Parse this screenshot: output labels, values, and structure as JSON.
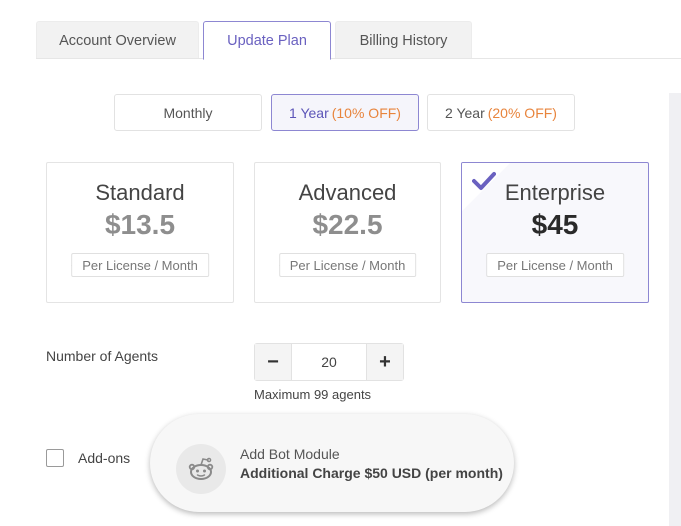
{
  "tabs": [
    {
      "label": "Account Overview",
      "active": false
    },
    {
      "label": "Update Plan",
      "active": true
    },
    {
      "label": "Billing History",
      "active": false
    }
  ],
  "durations": [
    {
      "label": "Monthly",
      "discount": ""
    },
    {
      "label": "1 Year",
      "discount": "(10% OFF)",
      "active": true
    },
    {
      "label": "2 Year",
      "discount": "(20% OFF)"
    }
  ],
  "plans": [
    {
      "name": "Standard",
      "price": "$13.5",
      "unit": "Per License / Month",
      "selected": false
    },
    {
      "name": "Advanced",
      "price": "$22.5",
      "unit": "Per License / Month",
      "selected": false
    },
    {
      "name": "Enterprise",
      "price": "$45",
      "unit": "Per License / Month",
      "selected": true
    }
  ],
  "agents": {
    "label": "Number of Agents",
    "value": "20",
    "minus": "−",
    "plus": "+",
    "max_note": "Maximum 99 agents"
  },
  "addons": {
    "label": "Add-ons",
    "checked": false,
    "module_title": "Add Bot Module",
    "module_charge": "Additional Charge $50 USD (per month)",
    "module_icon": "reddit-bot-icon"
  },
  "colors": {
    "accent": "#6a61c0",
    "discount": "#e8843c",
    "selected_bg": "#f8f8fc"
  }
}
